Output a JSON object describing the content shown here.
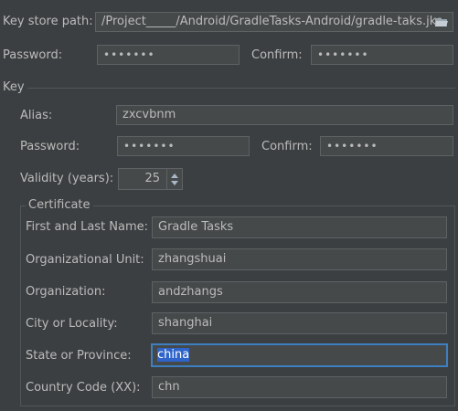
{
  "keystore": {
    "path_label": "Key store path:",
    "path_value": "/Project_____/Android/GradleTasks-Android/gradle-taks.jks",
    "password_label": "Password:",
    "password_value": "•••••••",
    "confirm_label": "Confirm:",
    "confirm_value": "•••••••"
  },
  "key": {
    "section_title": "Key",
    "alias_label": "Alias:",
    "alias_value": "zxcvbnm",
    "password_label": "Password:",
    "password_value": "•••••••",
    "confirm_label": "Confirm:",
    "confirm_value": "•••••••",
    "validity_label": "Validity (years):",
    "validity_value": "25"
  },
  "certificate": {
    "legend": "Certificate",
    "first_last_name_label": "First and Last Name:",
    "first_last_name_value": "Gradle Tasks",
    "org_unit_label": "Organizational Unit:",
    "org_unit_value": "zhangshuai",
    "organization_label": "Organization:",
    "organization_value": "andzhangs",
    "city_label": "City or Locality:",
    "city_value": "shanghai",
    "state_label": "State or Province:",
    "state_value": "china",
    "country_label": "Country Code (XX):",
    "country_value": "chn"
  },
  "icons": {
    "browse": "folder-icon",
    "spinner_up": "chevron-up-icon",
    "spinner_down": "chevron-down-icon"
  }
}
